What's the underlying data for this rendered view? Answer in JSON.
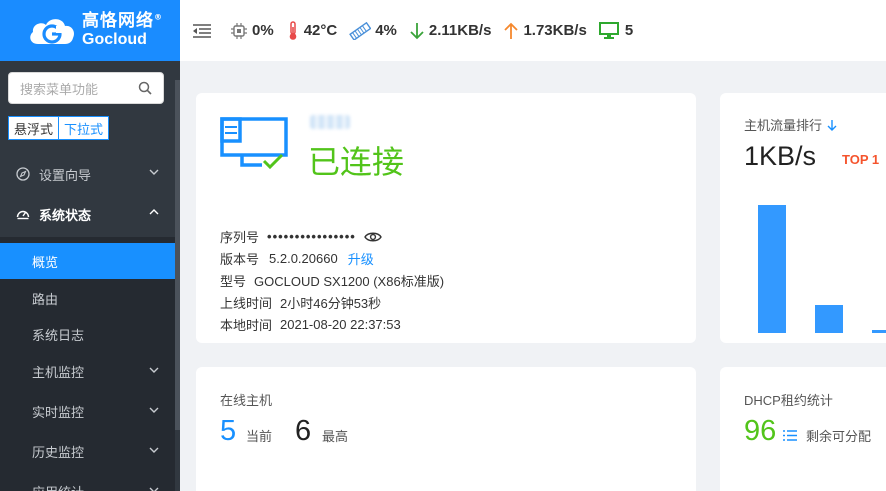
{
  "brand": {
    "name_cn": "高恪网络",
    "name_en": "Gocloud",
    "trademark": "®",
    "color": "#1a8cff"
  },
  "topbar": {
    "cpu": "0%",
    "temperature": "42°C",
    "memory": "4%",
    "download": "2.11KB/s",
    "upload": "1.73KB/s",
    "hosts": "5"
  },
  "sidebar": {
    "search_placeholder": "搜索菜单功能",
    "mode_float": "悬浮式",
    "mode_dropdown": "下拉式",
    "groups": [
      {
        "label": "设置向导",
        "icon": "compass-icon",
        "expanded": false
      },
      {
        "label": "系统状态",
        "icon": "dashboard-icon",
        "expanded": true
      }
    ],
    "sub_items": [
      {
        "label": "概览",
        "selected": true
      },
      {
        "label": "路由"
      },
      {
        "label": "系统日志"
      },
      {
        "label": "主机监控"
      },
      {
        "label": "实时监控"
      },
      {
        "label": "历史监控"
      },
      {
        "label": "应用统计"
      }
    ]
  },
  "device": {
    "status": "已连接",
    "serial_label": "序列号",
    "serial_value": "••••••••••••••••",
    "version_label": "版本号",
    "version_value": "5.2.0.20660",
    "upgrade_link": "升级",
    "model_label": "型号",
    "model_value": "GOCLOUD SX1200 (X86标准版)",
    "uptime_label": "上线时间",
    "uptime_value": "2小时46分钟53秒",
    "localtime_label": "本地时间",
    "localtime_value": "2021-08-20 22:37:53"
  },
  "traffic": {
    "title": "主机流量排行",
    "value": "1KB/s",
    "badge": "TOP 1",
    "chart_data": {
      "type": "bar",
      "values": [
        1.0,
        0.22,
        0.02
      ]
    }
  },
  "online_hosts": {
    "title": "在线主机",
    "current_value": "5",
    "current_label": "当前",
    "max_value": "6",
    "max_label": "最高"
  },
  "dhcp": {
    "title": "DHCP租约统计",
    "value": "96",
    "label": "剩余可分配"
  },
  "colors": {
    "accent": "#1890ff",
    "success": "#52c41a",
    "sidebar": "#313840",
    "temperature": "#e84a4a",
    "upload": "#f5882d",
    "download": "#3aa33a"
  }
}
